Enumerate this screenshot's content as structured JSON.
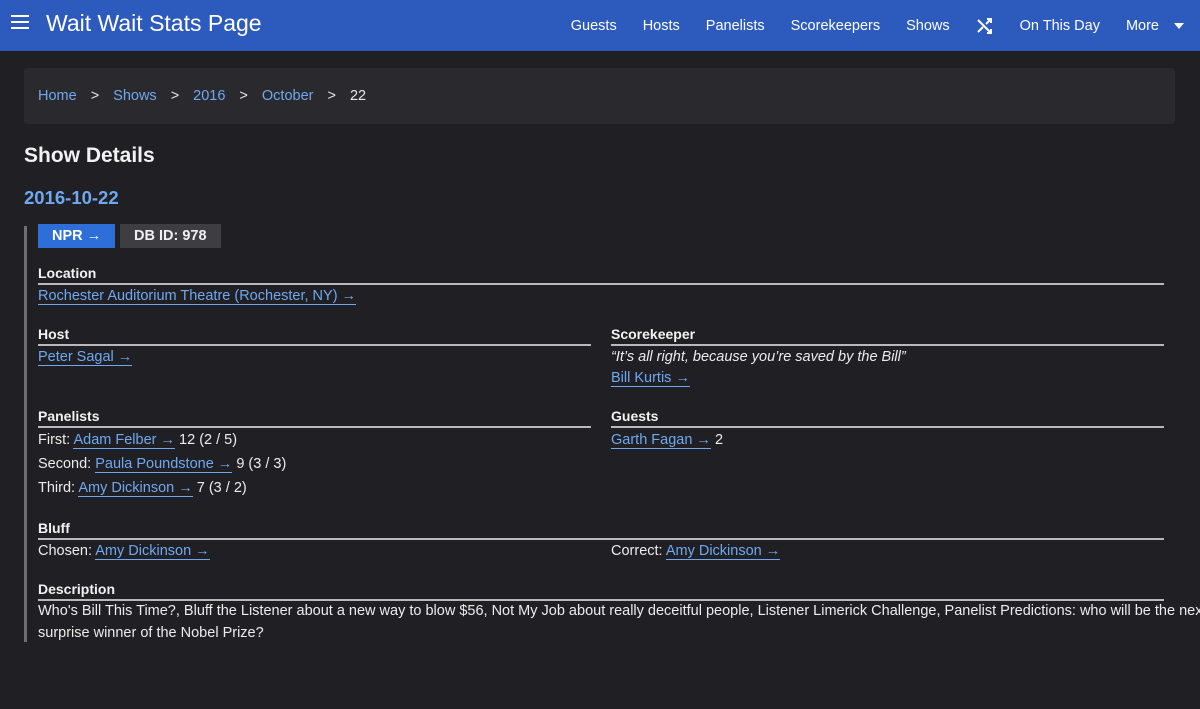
{
  "nav": {
    "brand": "Wait Wait Stats Page",
    "items": [
      "Guests",
      "Hosts",
      "Panelists",
      "Scorekeepers",
      "Shows"
    ],
    "shuffle_icon": "shuffle-icon",
    "on_this_day": "On This Day",
    "more": "More"
  },
  "breadcrumb": {
    "home": "Home",
    "shows": "Shows",
    "year": "2016",
    "month": "October",
    "current": "22",
    "separator": ">"
  },
  "page_title": "Show Details",
  "show": {
    "date": "2016-10-22",
    "npr_link": "NPR →",
    "db_id": "DB ID: 978",
    "location_label": "Location",
    "location": "Rochester Auditorium Theatre (Rochester, NY) →",
    "host_label": "Host",
    "host": "Peter Sagal →",
    "scorekeeper_label": "Scorekeeper",
    "scorekeeper_quote": "“It’s all right, because you’re saved by the Bill”",
    "scorekeeper": "Bill Kurtis →",
    "panelists_label": "Panelists",
    "panelists": [
      {
        "pos": "First:",
        "name": "Adam Felber →",
        "score": "12 (2 / 5)"
      },
      {
        "pos": "Second:",
        "name": "Paula Poundstone →",
        "score": "9 (3 / 3)"
      },
      {
        "pos": "Third:",
        "name": "Amy Dickinson →",
        "score": "7 (3 / 2)"
      }
    ],
    "guests_label": "Guests",
    "guest": "Garth Fagan →",
    "guest_score": "2",
    "bluff_label": "Bluff",
    "chosen_label": "Chosen:",
    "chosen": "Amy Dickinson →",
    "correct_label": "Correct:",
    "correct": "Amy Dickinson →",
    "description_label": "Description",
    "description_line1": "Who's Bill This Time?, Bluff the Listener about a new way to blow $56, Not My Job about really deceitful people, Listener Limerick Challenge, Panelist Predictions: who will be the next",
    "description_line2": "surprise winner of the Nobel Prize?"
  }
}
